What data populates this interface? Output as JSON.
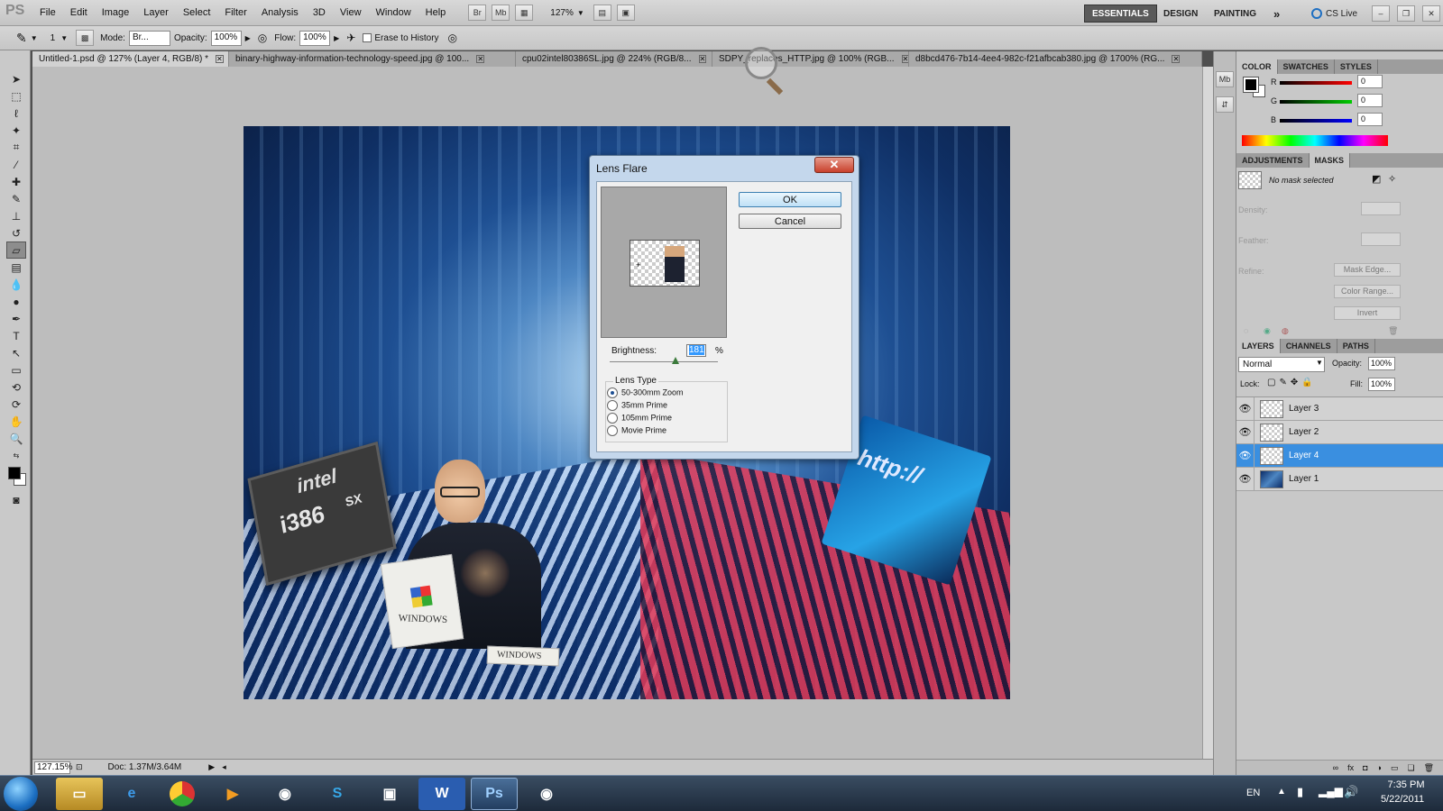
{
  "app": {
    "logo": "PS"
  },
  "menu": [
    "File",
    "Edit",
    "Image",
    "Layer",
    "Select",
    "Filter",
    "Analysis",
    "3D",
    "View",
    "Window",
    "Help"
  ],
  "menubar_buttons": {
    "bridge": "Br",
    "minibridge": "Mb",
    "zoom": "127%"
  },
  "workspaces": {
    "essentials": "ESSENTIALS",
    "design": "DESIGN",
    "painting": "PAINTING",
    "more": "»",
    "cslive": "CS Live"
  },
  "options": {
    "brush_size": "1",
    "mode_label": "Mode:",
    "mode_value": "Br...",
    "opacity_label": "Opacity:",
    "opacity_value": "100%",
    "flow_label": "Flow:",
    "flow_value": "100%",
    "erase_label": "Erase to History"
  },
  "tabs": [
    {
      "label": "Untitled-1.psd @ 127% (Layer 4, RGB/8) *"
    },
    {
      "label": "binary-highway-information-technology-speed.jpg @ 100..."
    },
    {
      "label": "cpu02intel80386SL.jpg @ 224% (RGB/8..."
    },
    {
      "label": "SDPY_replaces_HTTP.jpg @ 100% (RGB..."
    },
    {
      "label": "d8bcd476-7b14-4ee4-982c-f21afbcab380.jpg @ 1700% (RG..."
    }
  ],
  "status": {
    "zoom": "127.15%",
    "doc": "Doc: 1.37M/3.64M"
  },
  "artwork_text": {
    "intel": "intel",
    "i386": "i386",
    "sx": "SX",
    "windows_box": "WINDOWS",
    "windows_flag": "WINDOWS",
    "http": "http://"
  },
  "dialog": {
    "title": "Lens Flare",
    "close": "✕",
    "ok": "OK",
    "cancel": "Cancel",
    "brightness_label": "Brightness:",
    "brightness_value": "181",
    "percent": "%",
    "lens_type_label": "Lens Type",
    "lens_options": [
      "50-300mm Zoom",
      "35mm Prime",
      "105mm Prime",
      "Movie Prime"
    ],
    "selected_lens": "50-300mm Zoom"
  },
  "color_panel": {
    "tabs": [
      "COLOR",
      "SWATCHES",
      "STYLES"
    ],
    "r_label": "R",
    "g_label": "G",
    "b_label": "B",
    "r_value": "0",
    "g_value": "0",
    "b_value": "0"
  },
  "masks_panel": {
    "tabs": [
      "ADJUSTMENTS",
      "MASKS"
    ],
    "no_mask": "No mask selected",
    "density": "Density:",
    "feather": "Feather:",
    "refine": "Refine:",
    "mask_edge": "Mask Edge...",
    "color_range": "Color Range...",
    "invert": "Invert"
  },
  "layers_panel": {
    "tabs": [
      "LAYERS",
      "CHANNELS",
      "PATHS"
    ],
    "blend": "Normal",
    "opacity_label": "Opacity:",
    "opacity_value": "100%",
    "lock_label": "Lock:",
    "fill_label": "Fill:",
    "fill_value": "100%",
    "layers": [
      {
        "name": "Layer 3"
      },
      {
        "name": "Layer 2"
      },
      {
        "name": "Layer 4"
      },
      {
        "name": "Layer 1"
      }
    ],
    "selected": "Layer 4"
  },
  "taskbar": {
    "lang": "EN",
    "time": "7:35 PM",
    "date": "5/22/2011",
    "ps": "Ps",
    "word": "W",
    "skype": "S"
  },
  "colors": {
    "accent": "#3a8fe0",
    "panel": "#c8c8c8",
    "dialog_frame": "#c4d7ec"
  }
}
